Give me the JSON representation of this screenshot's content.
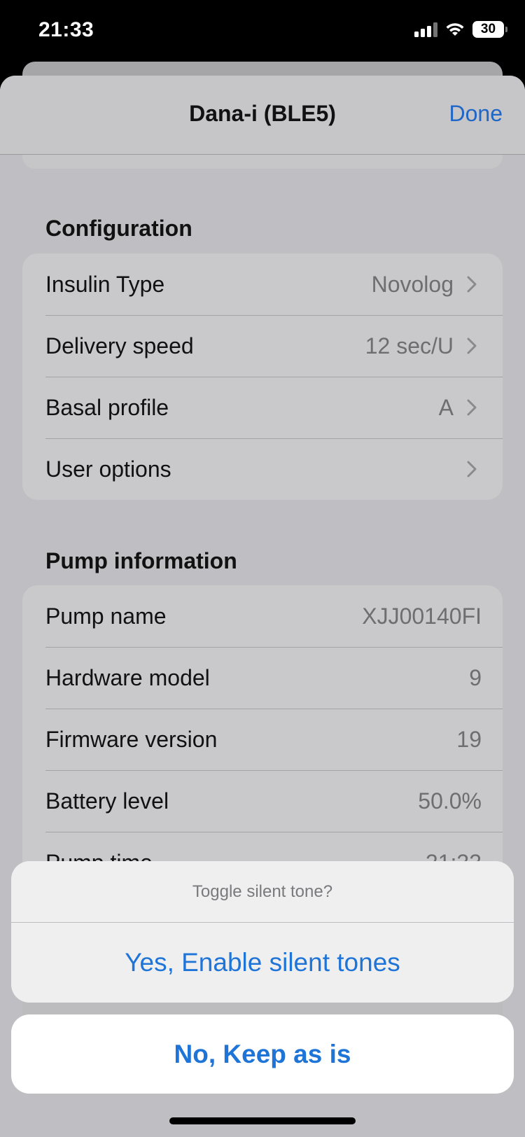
{
  "status_bar": {
    "time": "21:33",
    "battery_level": "30",
    "icons": [
      "cellular-signal-icon",
      "wifi-icon",
      "battery-icon"
    ]
  },
  "nav": {
    "title": "Dana-i (BLE5)",
    "done_label": "Done"
  },
  "configuration": {
    "header": "Configuration",
    "rows": [
      {
        "label": "Insulin Type",
        "value": "Novolog"
      },
      {
        "label": "Delivery speed",
        "value": "12 sec/U"
      },
      {
        "label": "Basal profile",
        "value": "A"
      },
      {
        "label": "User options",
        "value": ""
      }
    ]
  },
  "pump_information": {
    "header": "Pump information",
    "rows": [
      {
        "label": "Pump name",
        "value": "XJJ00140FI"
      },
      {
        "label": "Hardware model",
        "value": "9"
      },
      {
        "label": "Firmware version",
        "value": "19"
      },
      {
        "label": "Battery level",
        "value": "50.0%"
      },
      {
        "label": "Pump time",
        "value": "21:33"
      }
    ]
  },
  "action_sheet": {
    "title": "Toggle silent tone?",
    "confirm_label": "Yes, Enable silent tones",
    "cancel_label": "No, Keep as is"
  },
  "colors": {
    "accent": "#1f74d8",
    "sheet_background": "#bfbfc3"
  }
}
